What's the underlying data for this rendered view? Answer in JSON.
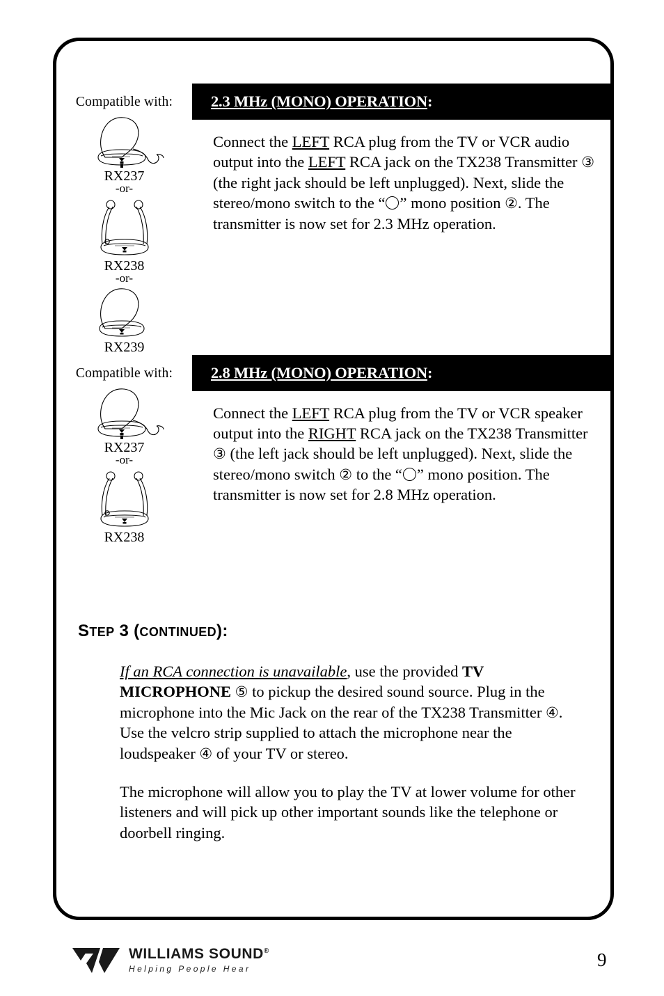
{
  "page": {
    "number": "9"
  },
  "table": {
    "rows": [
      {
        "compat_label": "Compatible with:",
        "devices": [
          {
            "name": "RX237",
            "art": "earpiece-receiver-with-cord",
            "or": "-or-"
          },
          {
            "name": "RX238",
            "art": "neckloop-receiver",
            "or": "-or-"
          },
          {
            "name": "RX239",
            "art": "earpiece-receiver",
            "or": ""
          }
        ],
        "band_title_prefix": "2.3 MHz (MONO) OPERATION",
        "band_title_suffix": ":",
        "body": {
          "seg1": "Connect the ",
          "u1": "LEFT",
          "seg2": " RCA plug from the TV or VCR audio output into the ",
          "u2": "LEFT",
          "seg3": " RCA jack on the TX238 Transmitter ",
          "c1": "③",
          "seg4": " (the right jack should be left unplugged).  Next, slide the stereo/mono switch to the “",
          "sym": "mono-circle-symbol",
          "seg5": "” mono position ",
          "c2": "②",
          "seg6": ".  The transmitter is now set for 2.3 MHz operation."
        }
      },
      {
        "compat_label": "Compatible with:",
        "devices": [
          {
            "name": "RX237",
            "art": "earpiece-receiver-with-cord",
            "or": "-or-"
          },
          {
            "name": "RX238",
            "art": "neckloop-receiver",
            "or": ""
          }
        ],
        "band_title_prefix": "2.8 MHz (MONO) OPERATION",
        "band_title_suffix": ":",
        "body": {
          "seg1": "Connect the ",
          "u1": "LEFT",
          "seg2": " RCA plug from the TV or VCR speaker output into the ",
          "u2": "RIGHT",
          "seg3": " RCA jack on the TX238 Transmitter ",
          "c1": "③",
          "seg4": " (the left jack should be left unplugged). Next, slide the stereo/mono switch ",
          "c2": "②",
          "seg5": " to the “",
          "sym": "mono-circle-symbol",
          "seg6": "” mono position. The transmitter is now set for 2.8 MHz operation."
        }
      }
    ]
  },
  "step": {
    "head_s": "S",
    "head_tep": "TEP",
    "head_num": " 3 (",
    "head_continued": "CONTINUED",
    "head_close": "):",
    "para1": {
      "italic_underline": "If an RCA connection is unavailable",
      "seg1": ", use the provided ",
      "bold": "TV MICROPHONE",
      "seg2": "  ",
      "c1": "⑤",
      "seg3": " to pickup the desired sound source. Plug in the microphone into the Mic Jack on the rear of the TX238 Transmitter ",
      "c2": "④",
      "seg4": ".  Use the velcro strip supplied to attach the microphone near the loudspeaker ",
      "c3": "④",
      "seg5": " of your TV or stereo."
    },
    "para2": "The microphone will allow you to play the TV at lower volume for other listeners and will pick up other important sounds like the telephone or doorbell ringing."
  },
  "footer": {
    "logo_mark": "williams-sound-w-mark",
    "brand": "WILLIAMS SOUND",
    "registered": "®",
    "tagline": "Helping People Hear"
  }
}
